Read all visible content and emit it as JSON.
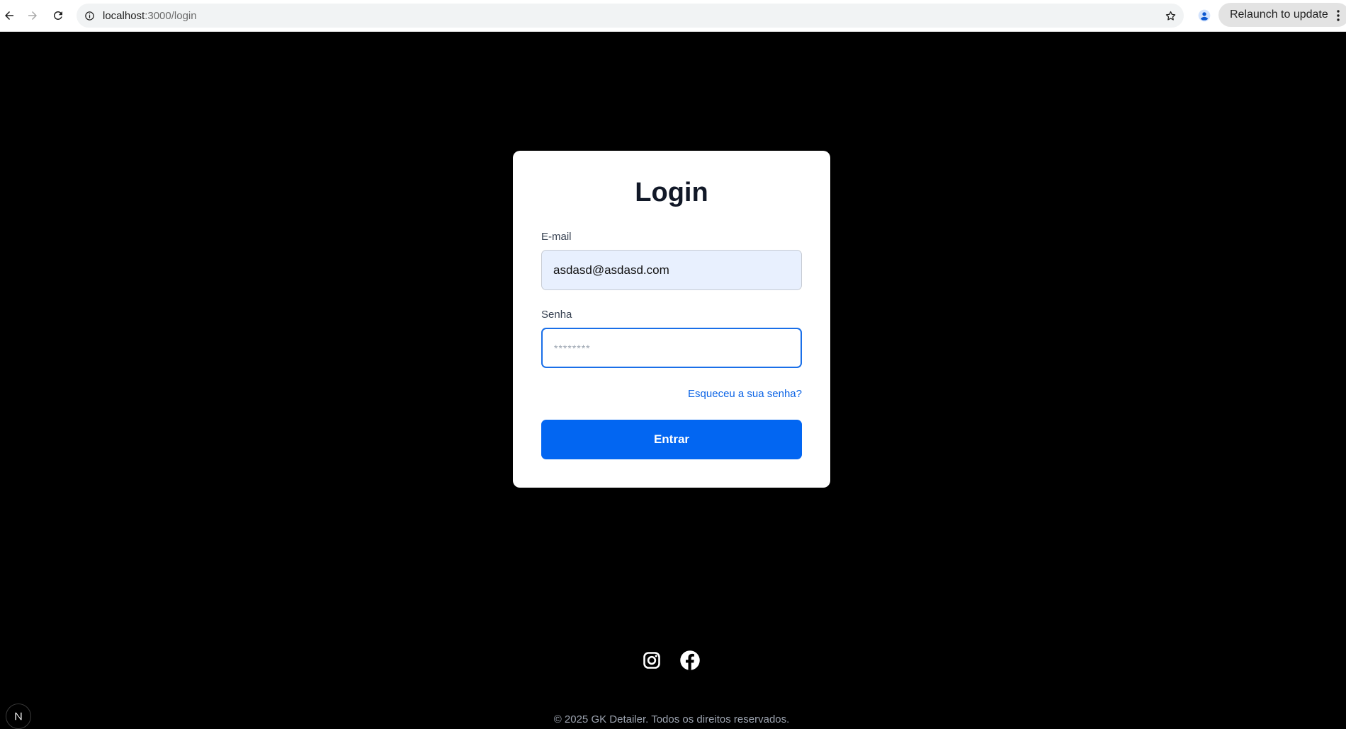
{
  "browser": {
    "url_host": "localhost",
    "url_path": ":3000/login",
    "relaunch_label": "Relaunch to update"
  },
  "login": {
    "title": "Login",
    "email_label": "E-mail",
    "email_value": "asdasd@asdasd.com",
    "password_label": "Senha",
    "password_placeholder": "********",
    "forgot_label": "Esqueceu a sua senha?",
    "submit_label": "Entrar"
  },
  "footer": {
    "copyright": "© 2025 GK Detailer. Todos os direitos reservados.",
    "social_icons": [
      "instagram-icon",
      "facebook-icon"
    ]
  },
  "colors": {
    "primary": "#0266f2",
    "link": "#0b63e5",
    "page_background": "#000000",
    "card_background": "#ffffff"
  }
}
